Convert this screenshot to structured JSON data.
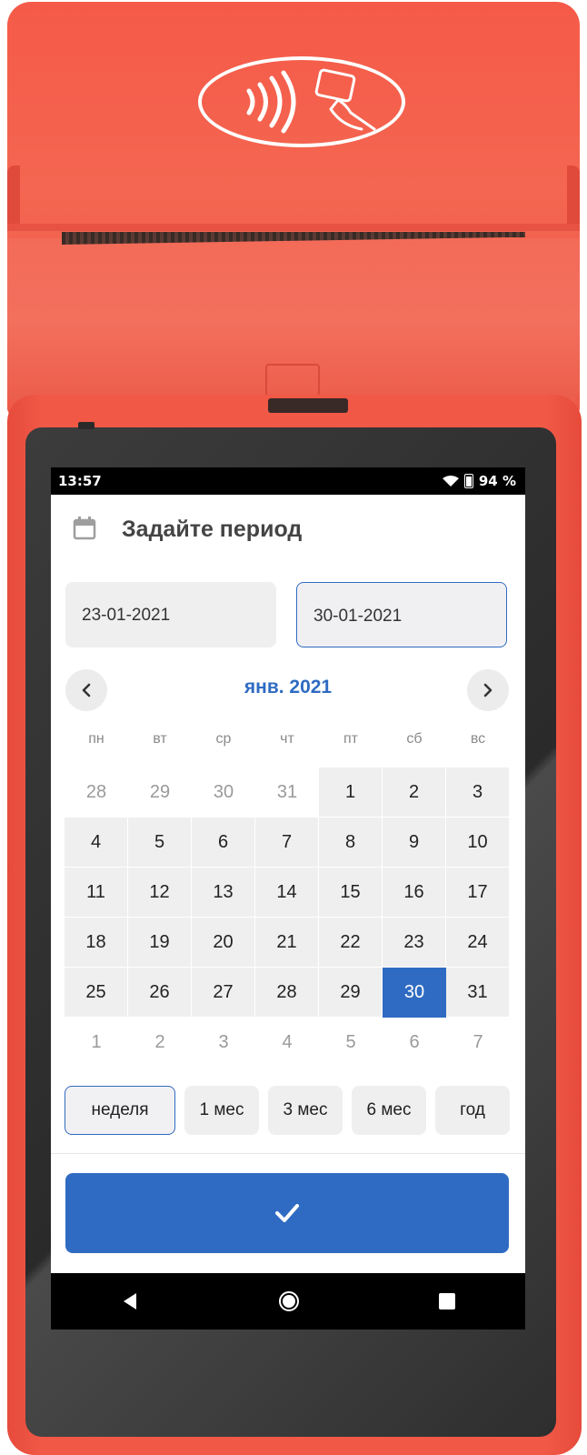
{
  "status_bar": {
    "time": "13:57",
    "battery_percent": "94 %"
  },
  "header": {
    "title": "Задайте период",
    "icon": "calendar-icon"
  },
  "date_range": {
    "start": "23-01-2021",
    "end": "30-01-2021"
  },
  "calendar": {
    "month_label": "янв. 2021",
    "weekdays": [
      "пн",
      "вт",
      "ср",
      "чт",
      "пт",
      "сб",
      "вс"
    ],
    "days": [
      {
        "d": "28",
        "type": "other"
      },
      {
        "d": "29",
        "type": "other"
      },
      {
        "d": "30",
        "type": "other"
      },
      {
        "d": "31",
        "type": "other"
      },
      {
        "d": "1",
        "type": "cur"
      },
      {
        "d": "2",
        "type": "cur"
      },
      {
        "d": "3",
        "type": "cur"
      },
      {
        "d": "4",
        "type": "cur"
      },
      {
        "d": "5",
        "type": "cur"
      },
      {
        "d": "6",
        "type": "cur"
      },
      {
        "d": "7",
        "type": "cur"
      },
      {
        "d": "8",
        "type": "cur"
      },
      {
        "d": "9",
        "type": "cur"
      },
      {
        "d": "10",
        "type": "cur"
      },
      {
        "d": "11",
        "type": "cur"
      },
      {
        "d": "12",
        "type": "cur"
      },
      {
        "d": "13",
        "type": "cur"
      },
      {
        "d": "14",
        "type": "cur"
      },
      {
        "d": "15",
        "type": "cur"
      },
      {
        "d": "16",
        "type": "cur"
      },
      {
        "d": "17",
        "type": "cur"
      },
      {
        "d": "18",
        "type": "cur"
      },
      {
        "d": "19",
        "type": "cur"
      },
      {
        "d": "20",
        "type": "cur"
      },
      {
        "d": "21",
        "type": "cur"
      },
      {
        "d": "22",
        "type": "cur"
      },
      {
        "d": "23",
        "type": "cur"
      },
      {
        "d": "24",
        "type": "cur"
      },
      {
        "d": "25",
        "type": "cur"
      },
      {
        "d": "26",
        "type": "cur"
      },
      {
        "d": "27",
        "type": "cur"
      },
      {
        "d": "28",
        "type": "cur"
      },
      {
        "d": "29",
        "type": "cur"
      },
      {
        "d": "30",
        "type": "sel"
      },
      {
        "d": "31",
        "type": "cur"
      },
      {
        "d": "1",
        "type": "other"
      },
      {
        "d": "2",
        "type": "other"
      },
      {
        "d": "3",
        "type": "other"
      },
      {
        "d": "4",
        "type": "other"
      },
      {
        "d": "5",
        "type": "other"
      },
      {
        "d": "6",
        "type": "other"
      },
      {
        "d": "7",
        "type": "other"
      }
    ]
  },
  "presets": [
    {
      "label": "неделя",
      "active": true
    },
    {
      "label": "1 мес",
      "active": false
    },
    {
      "label": "3 мес",
      "active": false
    },
    {
      "label": "6 мес",
      "active": false
    },
    {
      "label": "год",
      "active": false
    }
  ],
  "colors": {
    "accent": "#2f6bc2",
    "device": "#f15846"
  }
}
